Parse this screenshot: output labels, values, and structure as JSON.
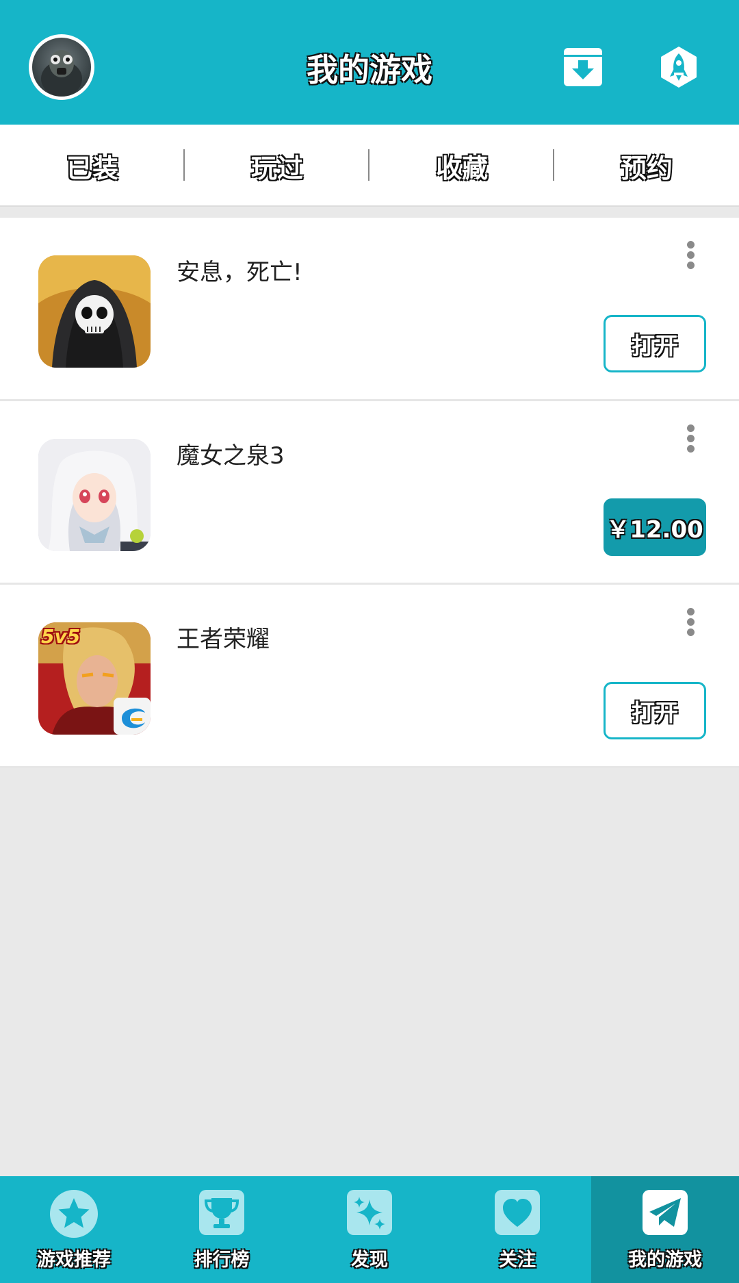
{
  "header": {
    "title": "我的游戏",
    "accent_color": "#16b5c8",
    "left_icon": "avatar",
    "right_icons": [
      "download-box-icon",
      "rocket-icon"
    ]
  },
  "tabs": [
    {
      "label": "已装"
    },
    {
      "label": "玩过"
    },
    {
      "label": "收藏"
    },
    {
      "label": "预约"
    }
  ],
  "games": [
    {
      "name": "安息，死亡!",
      "action": "打开",
      "action_type": "open",
      "icon": "skull-reaper-icon"
    },
    {
      "name": "魔女之泉3",
      "action": "￥12.00",
      "action_type": "price",
      "icon": "anime-girl-icon"
    },
    {
      "name": "王者荣耀",
      "action": "打开",
      "action_type": "open",
      "icon": "5v5-hero-icon",
      "icon_badge": "5v5"
    }
  ],
  "bottom_nav": [
    {
      "label": "游戏推荐",
      "icon": "star-icon",
      "active": false
    },
    {
      "label": "排行榜",
      "icon": "trophy-icon",
      "active": false
    },
    {
      "label": "发现",
      "icon": "sparkle-icon",
      "active": false
    },
    {
      "label": "关注",
      "icon": "heart-icon",
      "active": false
    },
    {
      "label": "我的游戏",
      "icon": "paper-plane-icon",
      "active": true
    }
  ]
}
